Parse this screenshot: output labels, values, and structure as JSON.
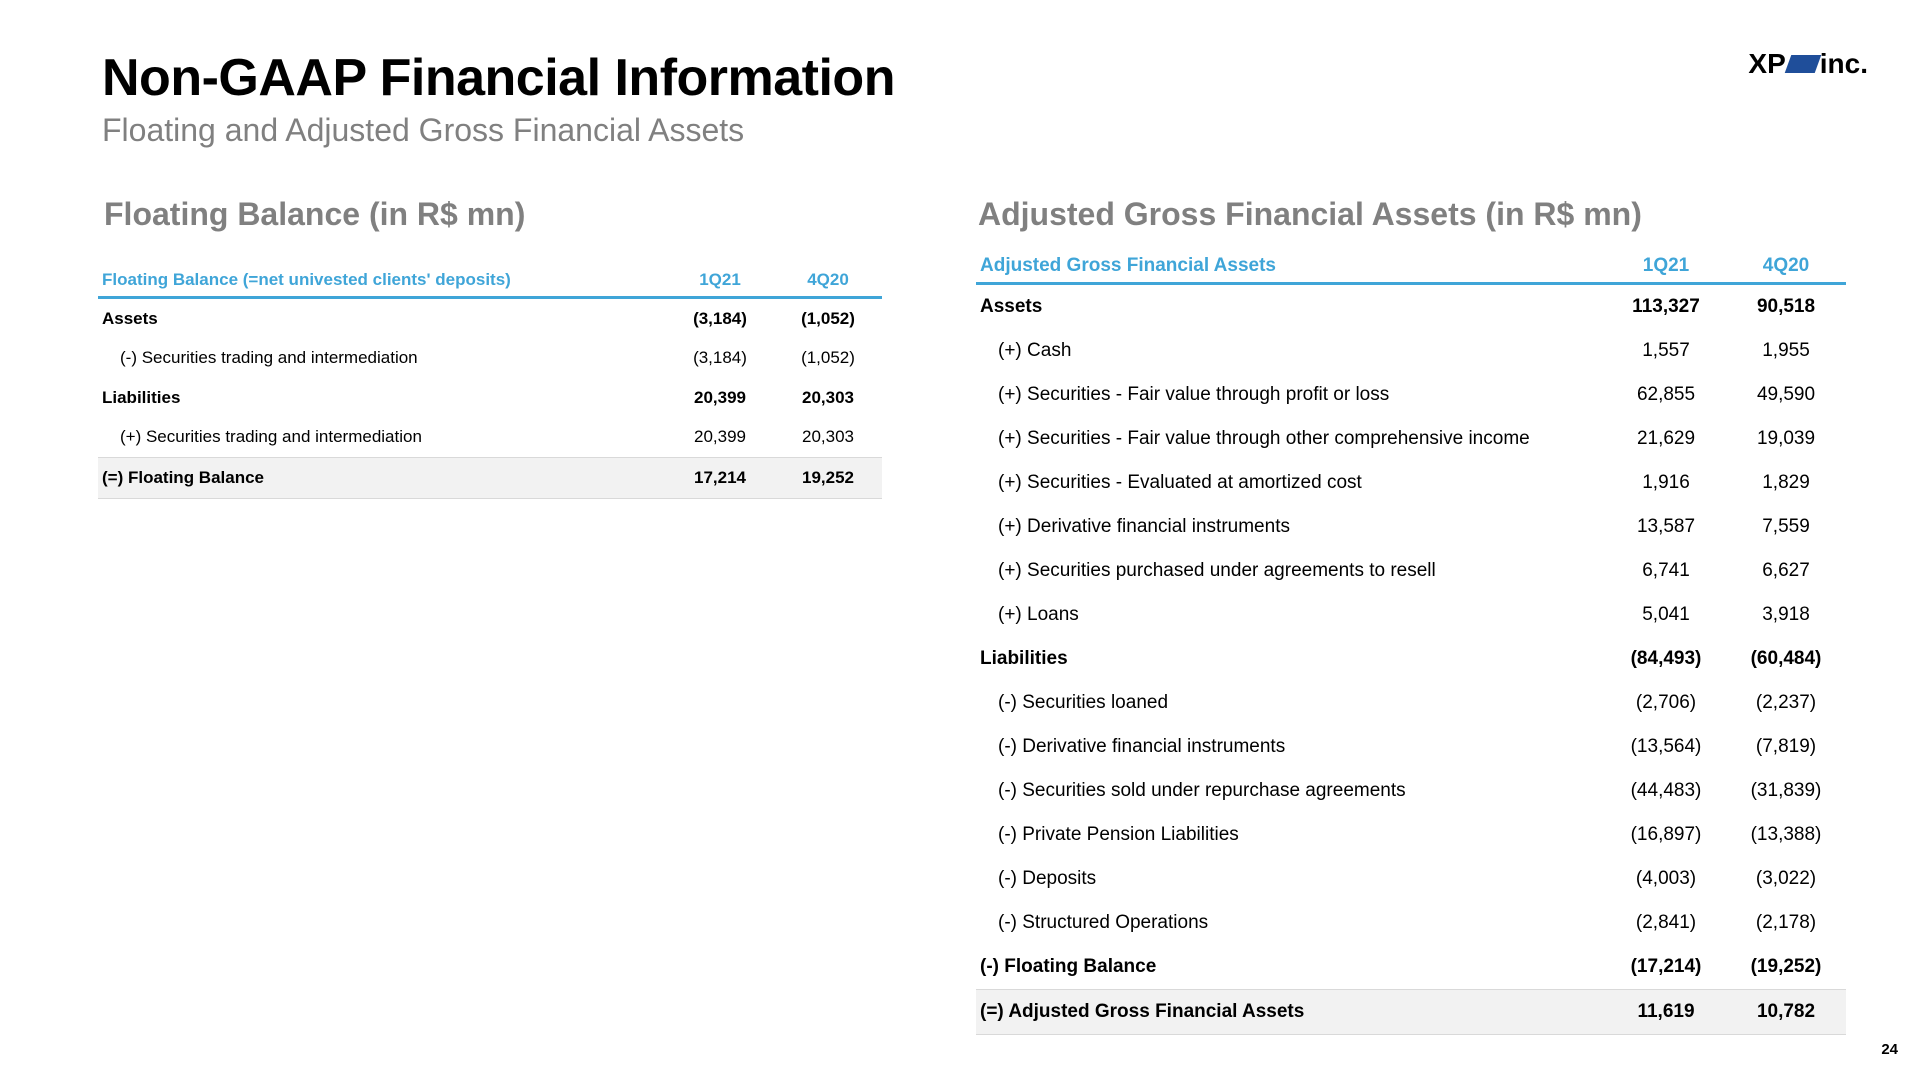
{
  "header": {
    "title": "Non-GAAP Financial Information",
    "subtitle": "Floating and Adjusted Gross Financial Assets",
    "logo_left": "XP",
    "logo_right": "inc."
  },
  "floating": {
    "section_title": "Floating Balance (in R$ mn)",
    "columns": [
      "Floating Balance (=net univested clients' deposits)",
      "1Q21",
      "4Q20"
    ],
    "rows": [
      {
        "label": "Assets",
        "q1": "(3,184)",
        "q2": "(1,052)"
      },
      {
        "label": "(-) Securities trading and intermediation",
        "q1": "(3,184)",
        "q2": "(1,052)"
      },
      {
        "label": "Liabilities",
        "q1": "20,399",
        "q2": "20,303"
      },
      {
        "label": "(+) Securities trading and intermediation",
        "q1": "20,399",
        "q2": "20,303"
      },
      {
        "label": "(=) Floating Balance",
        "q1": "17,214",
        "q2": "19,252"
      }
    ]
  },
  "adjusted": {
    "section_title": "Adjusted Gross Financial Assets (in R$ mn)",
    "columns": [
      "Adjusted Gross Financial Assets",
      "1Q21",
      "4Q20"
    ],
    "rows": [
      {
        "label": "Assets",
        "q1": "113,327",
        "q2": "90,518"
      },
      {
        "label": "(+) Cash",
        "q1": "1,557",
        "q2": "1,955"
      },
      {
        "label": "(+) Securities - Fair value through profit or loss",
        "q1": "62,855",
        "q2": "49,590"
      },
      {
        "label": "(+) Securities - Fair value through other comprehensive income",
        "q1": "21,629",
        "q2": "19,039"
      },
      {
        "label": "(+) Securities - Evaluated at amortized cost",
        "q1": "1,916",
        "q2": "1,829"
      },
      {
        "label": "(+) Derivative financial instruments",
        "q1": "13,587",
        "q2": "7,559"
      },
      {
        "label": "(+) Securities purchased under agreements to resell",
        "q1": "6,741",
        "q2": "6,627"
      },
      {
        "label": "(+) Loans",
        "q1": "5,041",
        "q2": "3,918"
      },
      {
        "label": "Liabilities",
        "q1": "(84,493)",
        "q2": "(60,484)"
      },
      {
        "label": "(-) Securities loaned",
        "q1": "(2,706)",
        "q2": "(2,237)"
      },
      {
        "label": "(-) Derivative financial instruments",
        "q1": "(13,564)",
        "q2": "(7,819)"
      },
      {
        "label": "(-) Securities sold under repurchase agreements",
        "q1": "(44,483)",
        "q2": "(31,839)"
      },
      {
        "label": "(-) Private Pension Liabilities",
        "q1": "(16,897)",
        "q2": "(13,388)"
      },
      {
        "label": "(-) Deposits",
        "q1": "(4,003)",
        "q2": "(3,022)"
      },
      {
        "label": "(-) Structured Operations",
        "q1": "(2,841)",
        "q2": "(2,178)"
      },
      {
        "label": "(-) Floating Balance",
        "q1": "(17,214)",
        "q2": "(19,252)"
      },
      {
        "label": "(=) Adjusted Gross Financial Assets",
        "q1": "11,619",
        "q2": "10,782"
      }
    ]
  },
  "page_number": "24"
}
